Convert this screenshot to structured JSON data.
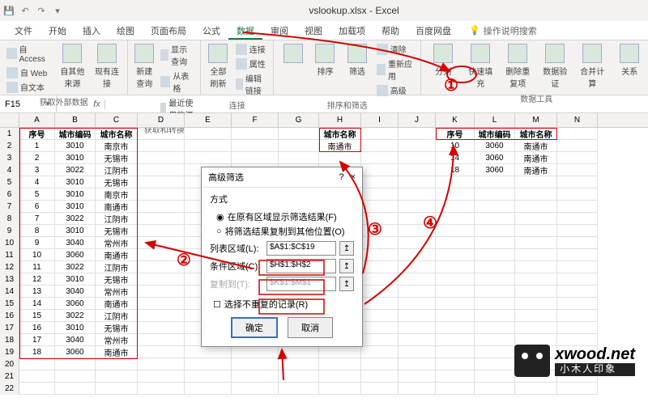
{
  "title": "vslookup.xlsx - Excel",
  "tabs": [
    "文件",
    "开始",
    "插入",
    "绘图",
    "页面布局",
    "公式",
    "数据",
    "审阅",
    "视图",
    "加载项",
    "帮助",
    "百度网盘"
  ],
  "active_tab_index": 6,
  "tell_me": "操作说明搜索",
  "ribbon_groups": {
    "g1": {
      "label": "获取外部数据",
      "items": [
        "自 Access",
        "自 Web",
        "自文本"
      ],
      "btn": "自其他来源",
      "btn2": "现有连接"
    },
    "g2": {
      "label": "获取和转换",
      "btn": "新建查询",
      "items": [
        "显示查询",
        "从表格",
        "最近使用的源"
      ]
    },
    "g3": {
      "label": "连接",
      "btn": "全部刷新",
      "items": [
        "连接",
        "属性",
        "编辑链接"
      ]
    },
    "g4": {
      "label": "排序和筛选",
      "btn1": "排序",
      "btn2": "筛选",
      "items": [
        "清除",
        "重新应用",
        "高级"
      ]
    },
    "g5": {
      "label": "数据工具",
      "btns": [
        "分列",
        "快速填充",
        "删除重复项",
        "数据验证",
        "合并计算",
        "关系"
      ]
    }
  },
  "namebox": "F15",
  "fx_label": "fx",
  "cols": [
    "A",
    "B",
    "C",
    "D",
    "E",
    "F",
    "G",
    "H",
    "I",
    "J",
    "K",
    "L",
    "M",
    "N"
  ],
  "sheet": {
    "headers_main": [
      "序号",
      "城市编码",
      "城市名称"
    ],
    "rows_main": [
      [
        "1",
        "3010",
        "南京市"
      ],
      [
        "2",
        "3010",
        "无锡市"
      ],
      [
        "3",
        "3022",
        "江阴市"
      ],
      [
        "4",
        "3010",
        "无锡市"
      ],
      [
        "5",
        "3010",
        "南京市"
      ],
      [
        "6",
        "3010",
        "南通市"
      ],
      [
        "7",
        "3022",
        "江阴市"
      ],
      [
        "8",
        "3010",
        "无锡市"
      ],
      [
        "9",
        "3040",
        "常州市"
      ],
      [
        "10",
        "3060",
        "南通市"
      ],
      [
        "11",
        "3022",
        "江阴市"
      ],
      [
        "12",
        "3010",
        "无锡市"
      ],
      [
        "13",
        "3040",
        "常州市"
      ],
      [
        "14",
        "3060",
        "南通市"
      ],
      [
        "15",
        "3022",
        "江阴市"
      ],
      [
        "16",
        "3010",
        "无锡市"
      ],
      [
        "17",
        "3040",
        "常州市"
      ],
      [
        "18",
        "3060",
        "南通市"
      ]
    ],
    "headers_h": [
      "城市名称"
    ],
    "rows_h": [
      [
        "南通市"
      ]
    ],
    "headers_k": [
      "序号",
      "城市编码",
      "城市名称"
    ],
    "rows_k": [
      [
        "10",
        "3060",
        "南通市"
      ],
      [
        "14",
        "3060",
        "南通市"
      ],
      [
        "18",
        "3060",
        "南通市"
      ]
    ]
  },
  "dialog": {
    "title": "高级筛选",
    "section": "方式",
    "radio1": "在原有区域显示筛选结果(F)",
    "radio2": "将筛选结果复制到其他位置(O)",
    "field1_label": "列表区域(L):",
    "field1_value": "$A$1:$C$19",
    "field2_label": "条件区域(C):",
    "field2_value": "$H$1:$H$2",
    "field3_label": "复制到(T):",
    "field3_value": "$K$1:$M$1",
    "check": "选择不重复的记录(R)",
    "ok": "确定",
    "cancel": "取消",
    "help": "?",
    "close": "×"
  },
  "annotations": {
    "a1": "①",
    "a2": "②",
    "a3": "③",
    "a4": "④"
  },
  "watermark": {
    "domain": "xwood.net",
    "zh": "小木人印象"
  }
}
